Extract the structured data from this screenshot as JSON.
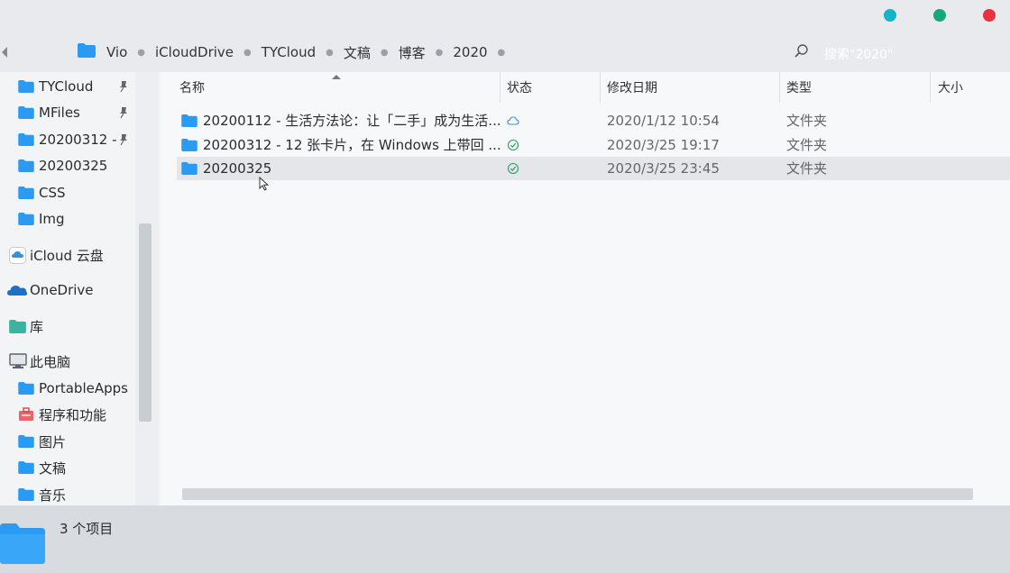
{
  "window": {
    "controls": [
      {
        "name": "minimize",
        "color": "#17b3c9"
      },
      {
        "name": "maximize",
        "color": "#16a77a"
      },
      {
        "name": "close",
        "color": "#e8323d"
      }
    ]
  },
  "address_bar": {
    "breadcrumbs": [
      "Vio",
      "iCloudDrive",
      "TYCloud",
      "文稿",
      "博客",
      "2020"
    ],
    "search_placeholder": "搜索\"2020\""
  },
  "sidebar": {
    "quick_access": [
      {
        "label": "TYCloud",
        "icon": "folder-icon",
        "pinned": true
      },
      {
        "label": "MFiles",
        "icon": "folder-icon",
        "pinned": true
      },
      {
        "label": "20200312 -",
        "icon": "folder-icon",
        "pinned": true
      },
      {
        "label": "20200325",
        "icon": "folder-icon",
        "pinned": false
      },
      {
        "label": "CSS",
        "icon": "folder-icon",
        "pinned": false
      },
      {
        "label": "Img",
        "icon": "folder-icon",
        "pinned": false
      }
    ],
    "icloud": {
      "label": "iCloud 云盘",
      "icon": "icloud-icon"
    },
    "onedrive": {
      "label": "OneDrive",
      "icon": "onedrive-icon"
    },
    "library": {
      "label": "库",
      "icon": "library-icon"
    },
    "this_pc": {
      "label": "此电脑",
      "icon": "computer-icon"
    },
    "pc_items": [
      {
        "label": "PortableApps",
        "icon": "folder-icon"
      },
      {
        "label": "程序和功能",
        "icon": "programs-icon"
      },
      {
        "label": "图片",
        "icon": "folder-icon"
      },
      {
        "label": "文稿",
        "icon": "folder-icon"
      },
      {
        "label": "音乐",
        "icon": "folder-icon"
      }
    ]
  },
  "file_list": {
    "columns": [
      "名称",
      "状态",
      "修改日期",
      "类型",
      "大小"
    ],
    "rows": [
      {
        "name": "20200112 - 生活方法论：让「二手」成为生活...",
        "status": "cloud-icon",
        "modified": "2020/1/12 10:54",
        "type": "文件夹",
        "size": ""
      },
      {
        "name": "20200312 - 12 张卡片，在 Windows 上带回 ...",
        "status": "synced-check-icon",
        "modified": "2020/3/25 19:17",
        "type": "文件夹",
        "size": ""
      },
      {
        "name": "20200325",
        "status": "synced-check-icon",
        "modified": "2020/3/25 23:45",
        "type": "文件夹",
        "size": "",
        "selected": true
      }
    ]
  },
  "status_bar": {
    "item_count": "3 个项目"
  },
  "colors": {
    "folder": "#2b9af3",
    "selection": "#e4e6e9",
    "synced": "#2a9d5c",
    "cloud": "#3a8fd6"
  }
}
